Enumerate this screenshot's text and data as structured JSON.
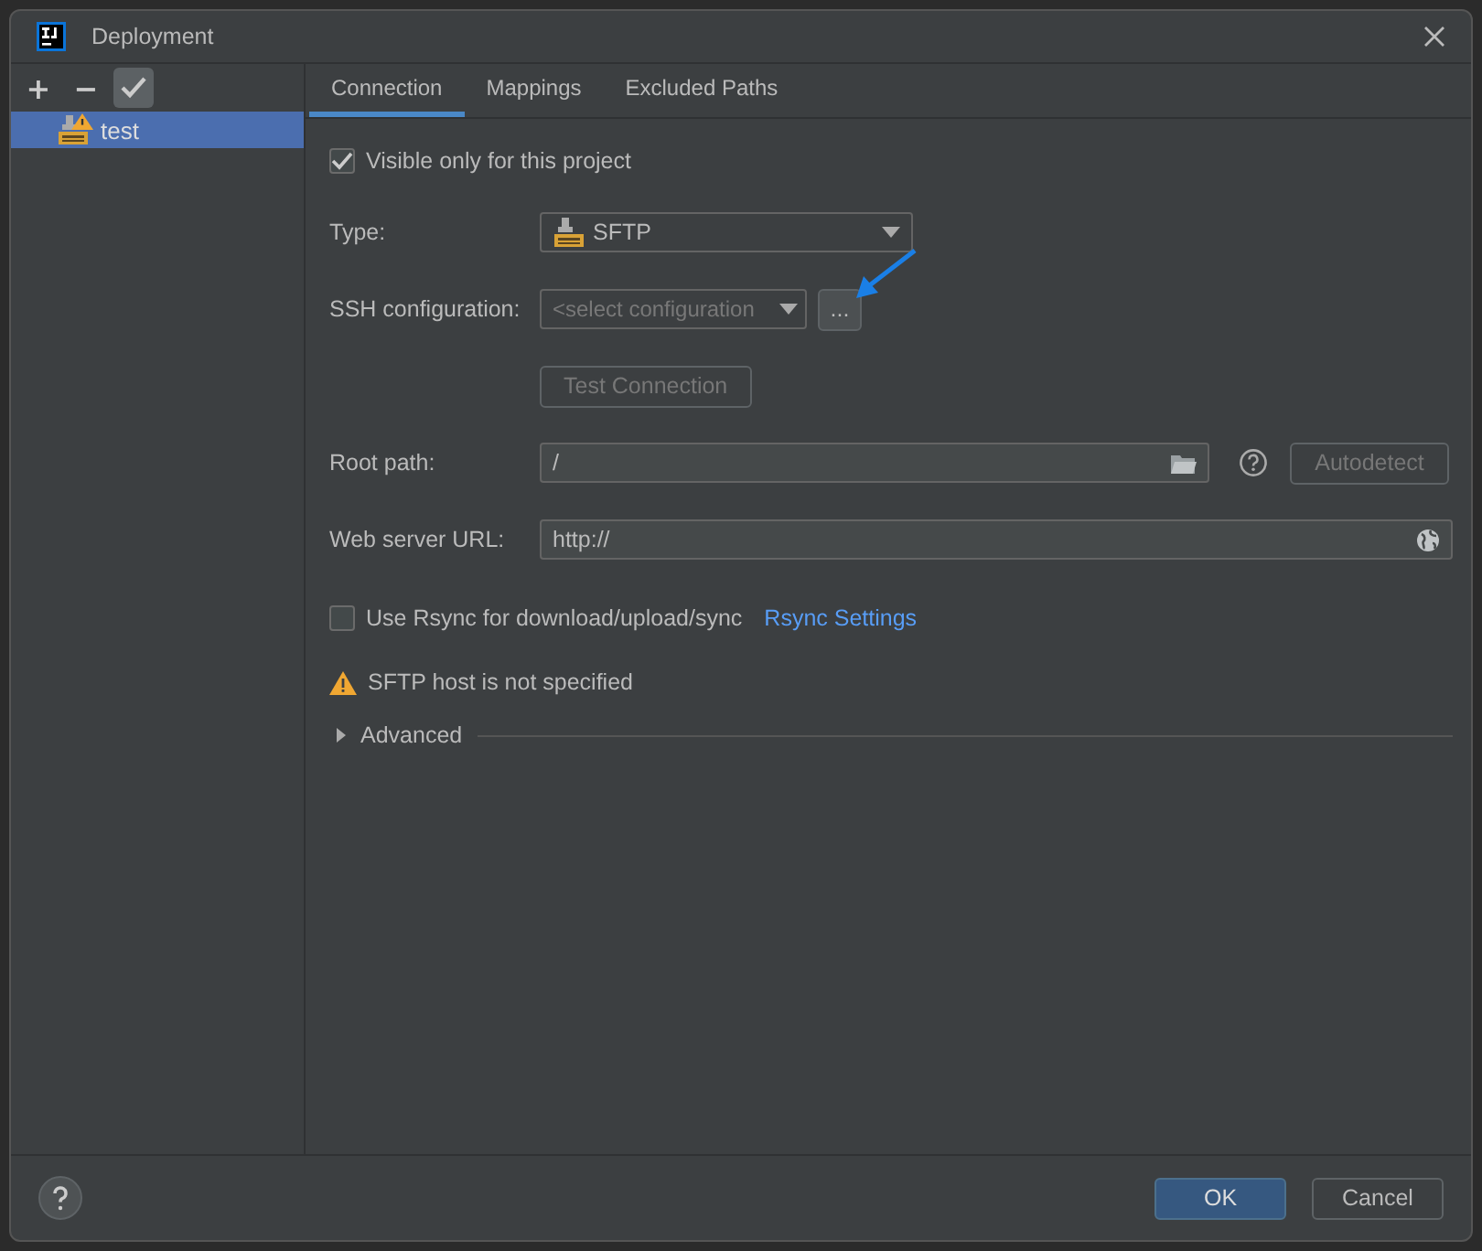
{
  "window": {
    "title": "Deployment"
  },
  "toolbar": {
    "add": "+",
    "remove": "−",
    "confirm_on": true
  },
  "servers": [
    {
      "name": "test",
      "selected": true,
      "warning": true
    }
  ],
  "tabs": [
    {
      "label": "Connection",
      "selected": true
    },
    {
      "label": "Mappings",
      "selected": false
    },
    {
      "label": "Excluded Paths",
      "selected": false
    }
  ],
  "visible_only": {
    "label": "Visible only for this project",
    "checked": true
  },
  "type": {
    "label": "Type:",
    "value": "SFTP"
  },
  "ssh": {
    "label": "SSH configuration:",
    "placeholder": "<select configuration",
    "more": "..."
  },
  "test_button": {
    "label": "Test Connection",
    "disabled": true
  },
  "root_path": {
    "label": "Root path:",
    "value": "/"
  },
  "autodetect": {
    "label": "Autodetect",
    "disabled": true
  },
  "web_url": {
    "label": "Web server URL:",
    "value": "http://"
  },
  "rsync": {
    "label": "Use Rsync for download/upload/sync",
    "checked": false,
    "link": "Rsync Settings"
  },
  "warning": "SFTP host is not specified",
  "advanced": {
    "label": "Advanced",
    "expanded": false
  },
  "footer": {
    "ok": "OK",
    "cancel": "Cancel"
  }
}
